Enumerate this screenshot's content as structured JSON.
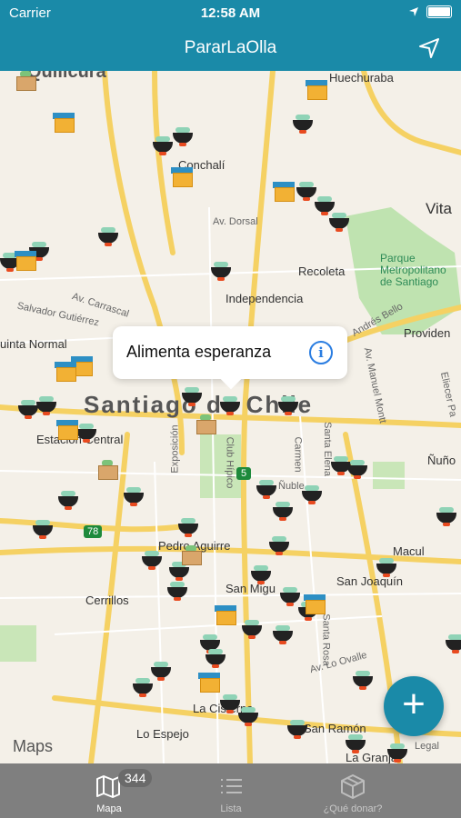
{
  "status_bar": {
    "carrier": "Carrier",
    "time": "12:58 AM"
  },
  "nav": {
    "title": "PararLaOlla"
  },
  "map": {
    "labels": {
      "quilicura": "Quilicura",
      "huechuraba": "Huechuraba",
      "conchali": "Conchalí",
      "vitacura": "Vita",
      "av_dorsal": "Av. Dorsal",
      "parque": "Parque\nMetropolitano\nde Santiago",
      "recoleta": "Recoleta",
      "independencia": "Independencia",
      "av_carrascal": "Av. Carrascal",
      "salvador": "Salvador Gutiérrez",
      "quinta_normal": "uinta Normal",
      "andres_bello": "Andrés Bello",
      "providencia": "Providen",
      "av_manuel_montt": "Av. Manuel Montt",
      "eliecer": "Eliecer Pa",
      "santiago": "Santiago de Chile",
      "estacion_central": "Estación Central",
      "exposicion": "Exposición",
      "club_hipico": "Club Hípico",
      "carmen": "Carmen",
      "santa_elena": "Santa Elena",
      "nunoa": "Ñuño",
      "nuble": "Ñuble",
      "pedro_aguirre": "Pedro Aguirre",
      "macul": "Macul",
      "san_joaquin": "San Joaquín",
      "cerrillos": "Cerrillos",
      "san_miguel": "San Migu",
      "santa_rosa": "Santa Rosa",
      "av_lo_ovalle": "Av. Lo Ovalle",
      "la_cisterna": "La Cisterna",
      "lo_espejo": "Lo Espejo",
      "san_ramon": "San Ramón",
      "la_granja": "La Granja",
      "route_5": "5",
      "route_78": "78"
    },
    "callout": {
      "title": "Alimenta esperanza",
      "info_icon": "info-icon"
    },
    "maps_attribution": "Maps",
    "legal": "Legal"
  },
  "fab": {
    "icon": "plus-icon"
  },
  "tabs": [
    {
      "label": "Mapa",
      "badge": "344",
      "icon": "map-icon",
      "active": true
    },
    {
      "label": "Lista",
      "icon": "list-icon",
      "active": false
    },
    {
      "label": "¿Qué donar?",
      "icon": "box-icon",
      "active": false
    }
  ],
  "colors": {
    "brand": "#1a8aa8",
    "tabbar": "#7f7f7f",
    "road": "#f5d163",
    "park": "#bfe3b0"
  }
}
